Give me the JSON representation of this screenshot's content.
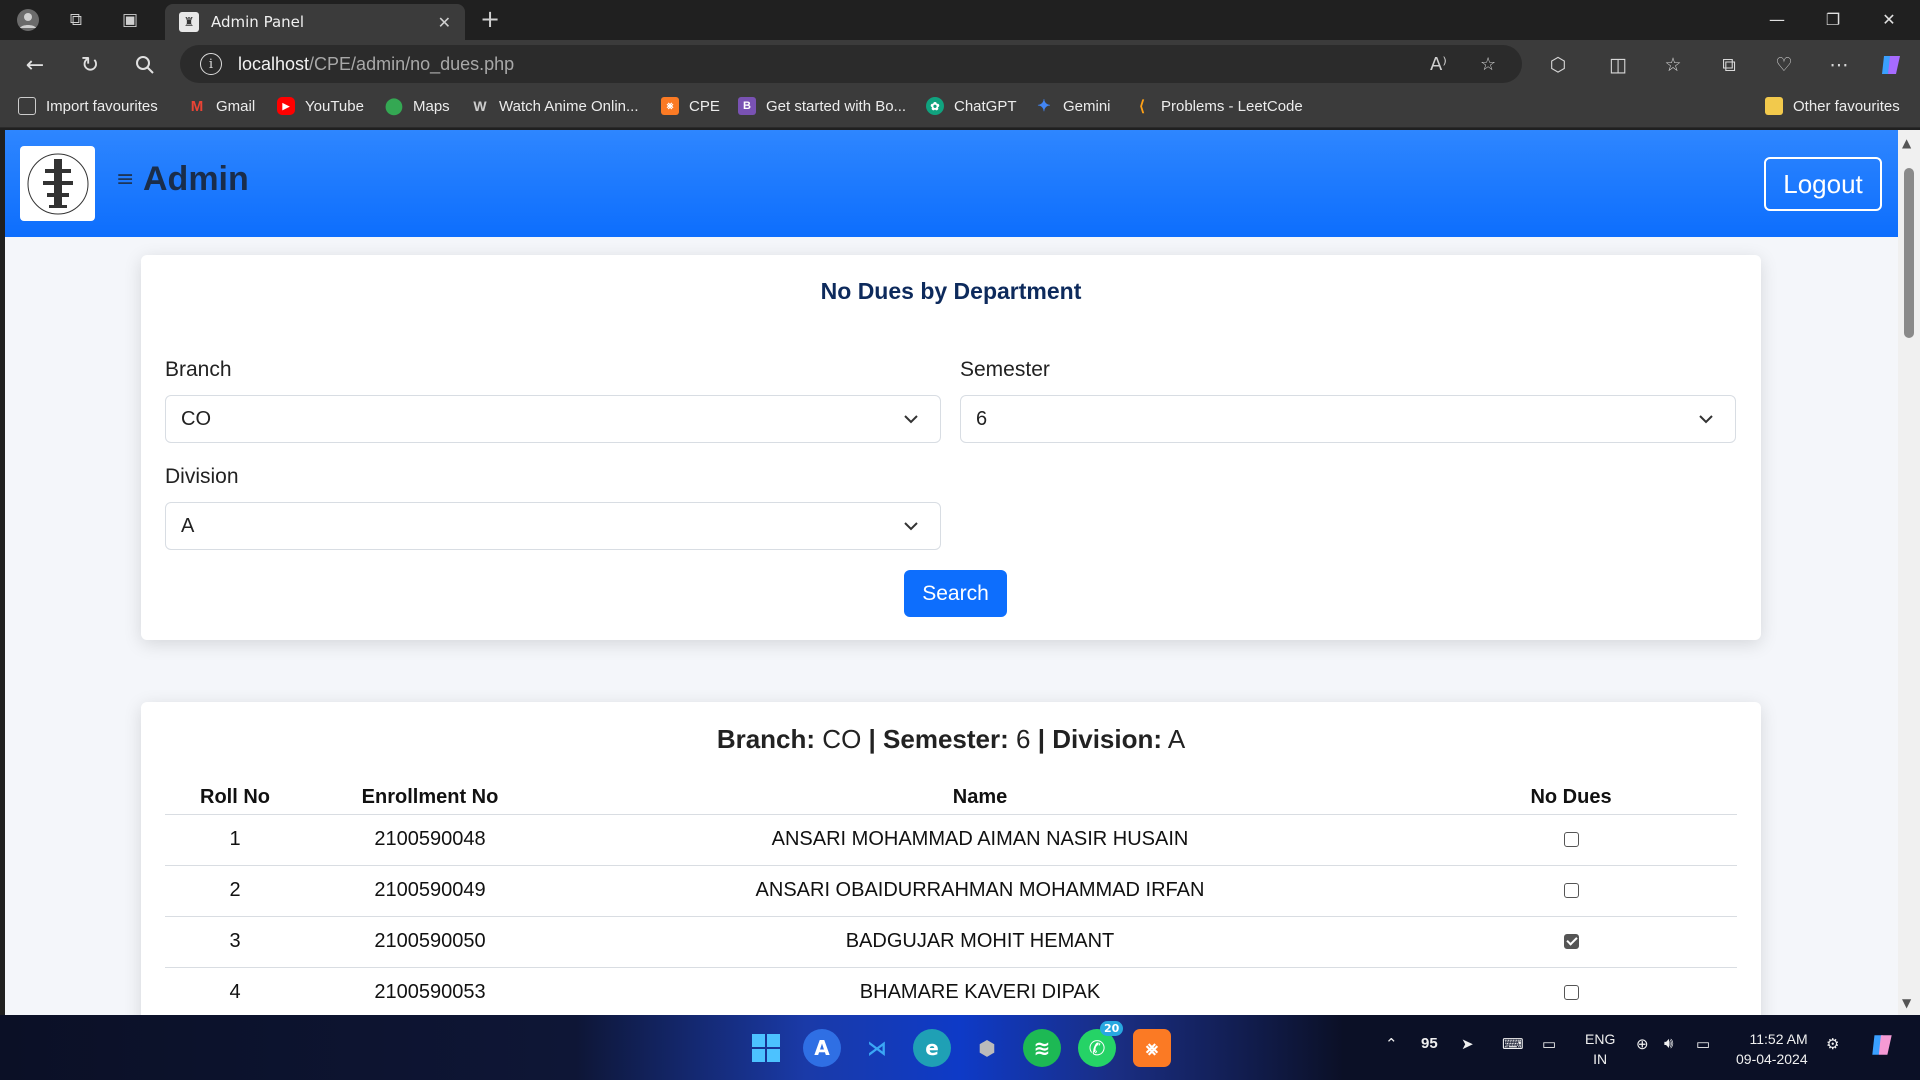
{
  "browser": {
    "tab_title": "Admin Panel",
    "url_host": "localhost",
    "url_path": "/CPE/admin/no_dues.php"
  },
  "bookmarks": [
    {
      "label": "Import favourites",
      "icon": "import-icon",
      "color": "#cccccc"
    },
    {
      "label": "Gmail",
      "icon": "gmail-icon",
      "color": "#ea4335"
    },
    {
      "label": "YouTube",
      "icon": "youtube-icon",
      "color": "#ff0000"
    },
    {
      "label": "Maps",
      "icon": "maps-icon",
      "color": "#34a853"
    },
    {
      "label": "Watch Anime Onlin...",
      "icon": "anime-icon",
      "color": "#888888"
    },
    {
      "label": "CPE",
      "icon": "xampp-icon",
      "color": "#fb7a24"
    },
    {
      "label": "Get started with Bo...",
      "icon": "bootstrap-icon",
      "color": "#7952b3"
    },
    {
      "label": "ChatGPT",
      "icon": "chatgpt-icon",
      "color": "#10a37f"
    },
    {
      "label": "Gemini",
      "icon": "gemini-icon",
      "color": "#4285f4"
    },
    {
      "label": "Problems - LeetCode",
      "icon": "leetcode-icon",
      "color": "#ffa116"
    }
  ],
  "other_favourites": "Other favourites",
  "header": {
    "title": "Admin",
    "logout_label": "Logout",
    "accent": "#0d6efd"
  },
  "filter_card": {
    "title": "No Dues by Department",
    "branch_label": "Branch",
    "branch_value": "CO",
    "semester_label": "Semester",
    "semester_value": "6",
    "division_label": "Division",
    "division_value": "A",
    "search_label": "Search"
  },
  "results": {
    "branch_key": "Branch:",
    "branch_val": "CO",
    "semester_key": "Semester:",
    "semester_val": "6",
    "division_key": "Division:",
    "division_val": "A",
    "separator": "|",
    "columns": [
      "Roll No",
      "Enrollment No",
      "Name",
      "No Dues"
    ],
    "rows": [
      {
        "roll": "1",
        "enrollment": "2100590048",
        "name": "ANSARI MOHAMMAD AIMAN NASIR HUSAIN",
        "no_dues": false
      },
      {
        "roll": "2",
        "enrollment": "2100590049",
        "name": "ANSARI OBAIDURRAHMAN MOHAMMAD IRFAN",
        "no_dues": false
      },
      {
        "roll": "3",
        "enrollment": "2100590050",
        "name": "BADGUJAR MOHIT HEMANT",
        "no_dues": true
      },
      {
        "roll": "4",
        "enrollment": "2100590053",
        "name": "BHAMARE KAVERI DIPAK",
        "no_dues": false
      }
    ]
  },
  "taskbar": {
    "whatsapp_badge": "20",
    "tray_number": "95",
    "lang_top": "ENG",
    "lang_bottom": "IN",
    "time": "11:52 AM",
    "date": "09-04-2024"
  }
}
